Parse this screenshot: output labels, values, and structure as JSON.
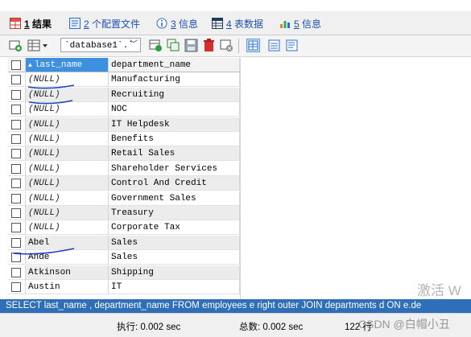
{
  "tabs": [
    {
      "num": "1",
      "label": "结果",
      "active": true
    },
    {
      "num": "2",
      "label": "个配置文件",
      "active": false
    },
    {
      "num": "3",
      "label": "信息",
      "active": false
    },
    {
      "num": "4",
      "label": "表数据",
      "active": false
    },
    {
      "num": "5",
      "label": "信息",
      "active": false
    }
  ],
  "toolbar": {
    "database_value": "`database1`.`"
  },
  "grid": {
    "columns": [
      "last_name",
      "department_name"
    ],
    "sort_indicator": "▲",
    "null_text": "(NULL)",
    "rows": [
      {
        "last_name": "(NULL)",
        "department_name": "Manufacturing"
      },
      {
        "last_name": "(NULL)",
        "department_name": "Recruiting"
      },
      {
        "last_name": "(NULL)",
        "department_name": "NOC"
      },
      {
        "last_name": "(NULL)",
        "department_name": "IT Helpdesk"
      },
      {
        "last_name": "(NULL)",
        "department_name": "Benefits"
      },
      {
        "last_name": "(NULL)",
        "department_name": "Retail Sales"
      },
      {
        "last_name": "(NULL)",
        "department_name": "Shareholder Services"
      },
      {
        "last_name": "(NULL)",
        "department_name": "Control And Credit"
      },
      {
        "last_name": "(NULL)",
        "department_name": "Government Sales"
      },
      {
        "last_name": "(NULL)",
        "department_name": "Treasury"
      },
      {
        "last_name": "(NULL)",
        "department_name": "Corporate Tax"
      },
      {
        "last_name": "Abel",
        "department_name": "Sales"
      },
      {
        "last_name": "Ande",
        "department_name": "Sales"
      },
      {
        "last_name": "Atkinson",
        "department_name": "Shipping"
      },
      {
        "last_name": "Austin",
        "department_name": "IT"
      }
    ]
  },
  "status": {
    "query": "SELECT last_name , department_name FROM employees e right outer JOIN departments d ON e.de"
  },
  "footer": {
    "exec_time": "执行: 0.002 sec",
    "total_time": "总数: 0.002 sec",
    "row_count": "122 行"
  },
  "watermarks": {
    "activate": "激活 W",
    "credit": "CSDN @白帽小丑"
  }
}
